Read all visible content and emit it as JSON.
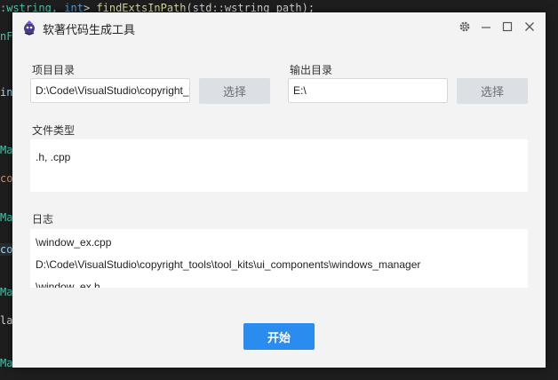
{
  "background_editor": {
    "top_line_prefix": ":wstring, ",
    "top_line_kw": "int",
    "top_line_mid": "> ",
    "top_line_fn": "findExtsInPath",
    "top_line_args": "(std::wstring path);",
    "gutter_fragments": [
      "nFo",
      "inF",
      "Mai",
      "cop",
      "Mai",
      "cop",
      "Mai",
      "las",
      "Mai"
    ]
  },
  "window": {
    "title": "软著代码生成工具",
    "icons": [
      "app-icon",
      "gear-icon",
      "minimize-icon",
      "maximize-icon",
      "close-icon"
    ]
  },
  "form": {
    "project_dir_label": "项目目录",
    "project_dir_value": "D:\\Code\\VisualStudio\\copyright_tools",
    "project_select_label": "选择",
    "output_dir_label": "输出目录",
    "output_dir_value": "E:\\",
    "output_select_label": "选择",
    "file_types_label": "文件类型",
    "file_types_value": ".h, .cpp",
    "log_label": "日志",
    "log_lines": [
      "\\window_ex.cpp",
      "D:\\Code\\VisualStudio\\copyright_tools\\tool_kits\\ui_components\\windows_manager",
      "\\window_ex.h"
    ],
    "start_label": "开始"
  },
  "colors": {
    "accent": "#2b8cf0",
    "window_bg": "#f3f3f3",
    "button_gray": "#dcdfe3",
    "editor_bg": "#1e1e1e"
  }
}
